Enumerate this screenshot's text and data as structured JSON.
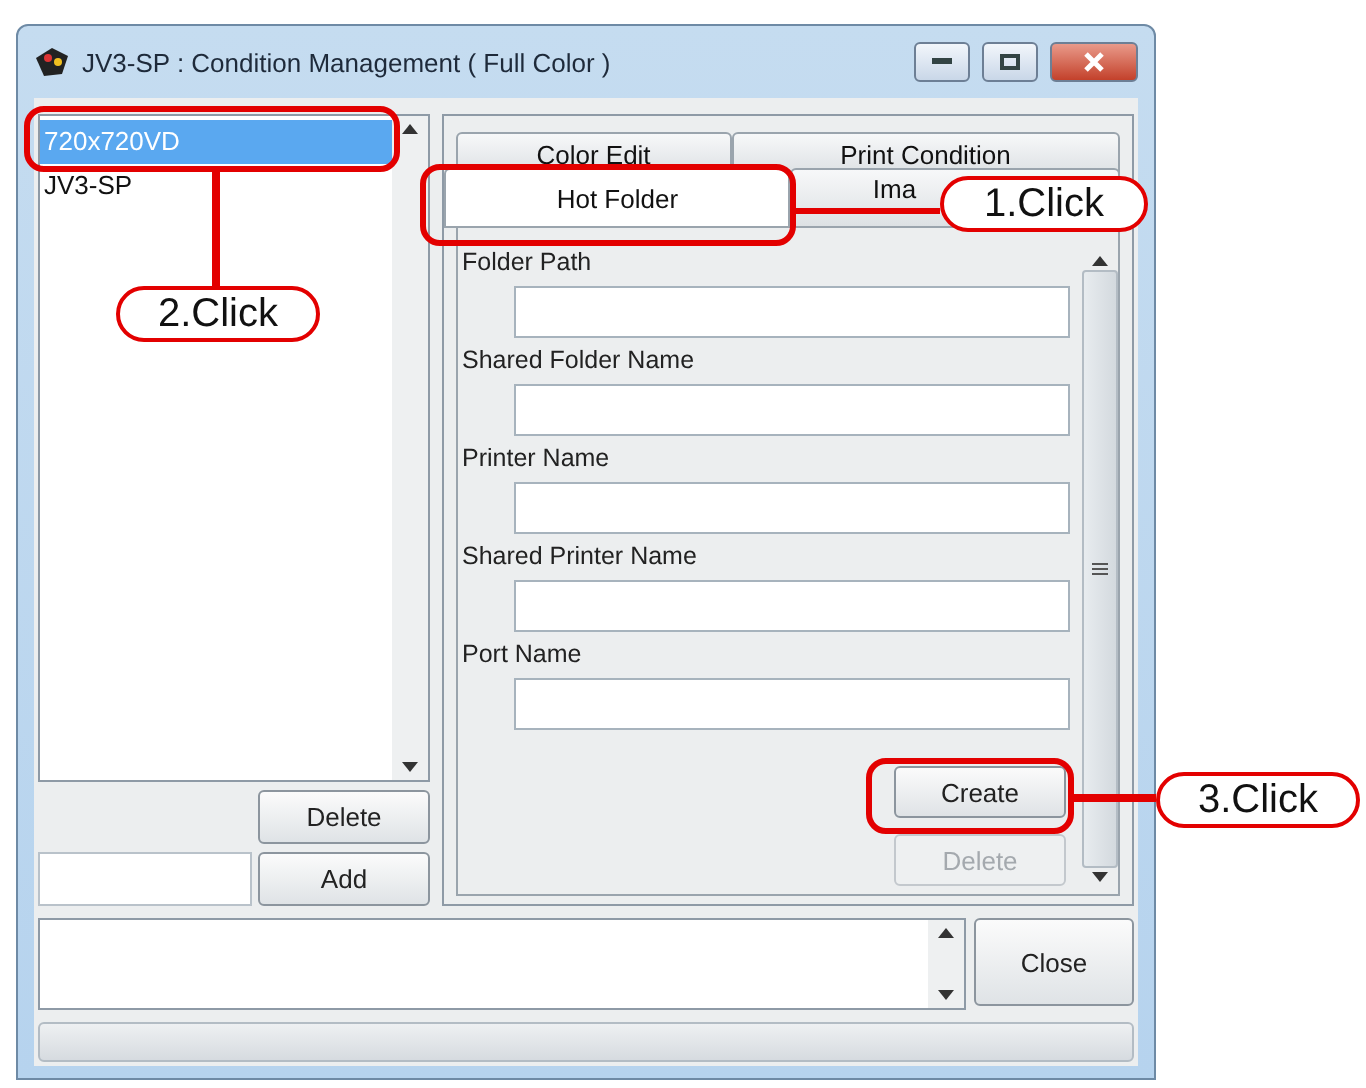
{
  "window": {
    "title": "JV3-SP : Condition Management ( Full Color )"
  },
  "conditions": {
    "items": [
      {
        "label": "720x720VD",
        "selected": true
      },
      {
        "label": "JV3-SP",
        "selected": false
      }
    ],
    "buttons": [
      {
        "label": "Delete",
        "disabled": false
      },
      {
        "label": "Add",
        "disabled": false
      }
    ]
  },
  "tabs": {
    "back_row": [
      {
        "label": "Color Edit",
        "selected": false
      },
      {
        "label": "Print Condition",
        "selected": false
      }
    ],
    "front_row": [
      {
        "label": "Hot Folder",
        "selected": true
      },
      {
        "label": "Ima",
        "selected": false
      }
    ]
  },
  "hot_folder": {
    "fields": [
      {
        "label": "Folder Path"
      },
      {
        "label": "Shared Folder Name"
      },
      {
        "label": "Printer Name"
      },
      {
        "label": "Shared Printer Name"
      },
      {
        "label": "Port Name"
      }
    ],
    "buttons": [
      {
        "label": "Create",
        "disabled": false
      },
      {
        "label": "Delete",
        "disabled": true
      }
    ]
  },
  "footer": {
    "close": "Close"
  },
  "progress": {
    "level": 0
  },
  "callouts": [
    {
      "label": "1.Click"
    },
    {
      "label": "2.Click"
    },
    {
      "label": "3.Click"
    }
  ]
}
